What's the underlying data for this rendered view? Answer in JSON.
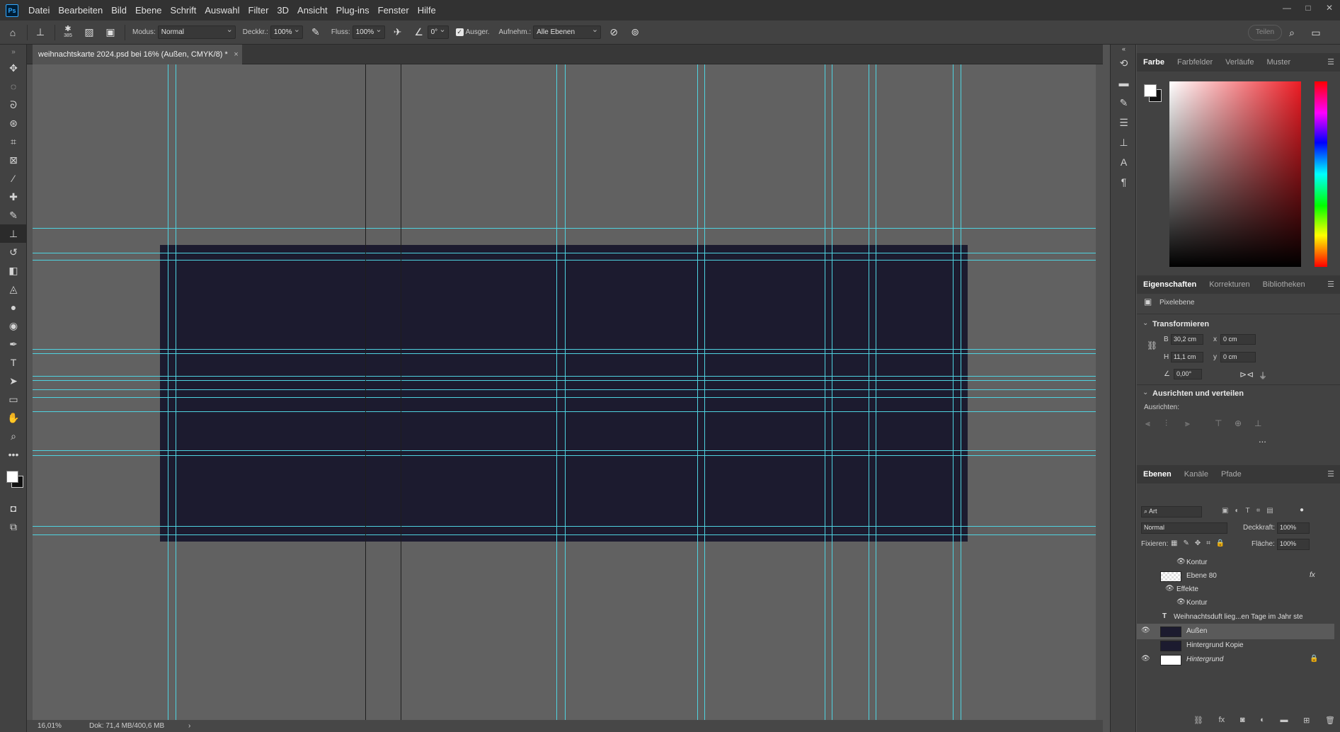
{
  "app": {
    "logo": "Ps"
  },
  "menu": [
    "Datei",
    "Bearbeiten",
    "Bild",
    "Ebene",
    "Schrift",
    "Auswahl",
    "Filter",
    "3D",
    "Ansicht",
    "Plug-ins",
    "Fenster",
    "Hilfe"
  ],
  "window_controls": {
    "minimize": "—",
    "maximize": "□",
    "close": "✕"
  },
  "options": {
    "brush_size": "385",
    "mode_label": "Modus:",
    "mode_value": "Normal",
    "opacity_label": "Deckkr.:",
    "opacity_value": "100%",
    "flow_label": "Fluss:",
    "flow_value": "100%",
    "angle_value": "0°",
    "aligned_label": "Ausger.",
    "sample_label": "Aufnehm.:",
    "sample_value": "Alle Ebenen",
    "share_label": "Teilen"
  },
  "document": {
    "tab_title": "weihnachtskarte 2024.psd bei 16% (Außen, CMYK/8) *",
    "close": "×",
    "artboard_color": "#1c1b2f",
    "guide_color": "#4fd3e0"
  },
  "status": {
    "zoom": "16,01%",
    "doc_info": "Dok: 71,4 MB/400,6 MB",
    "arrow": "›"
  },
  "color_panel": {
    "tabs": [
      "Farbe",
      "Farbfelder",
      "Verläufe",
      "Muster"
    ],
    "active_tab": "Farbe",
    "foreground": "#ffffff",
    "background": "#111111"
  },
  "properties_panel": {
    "tabs": [
      "Eigenschaften",
      "Korrekturen",
      "Bibliotheken"
    ],
    "active_tab": "Eigenschaften",
    "layer_type": "Pixelebene",
    "transform_title": "Transformieren",
    "width_label": "B",
    "width_value": "30,2 cm",
    "height_label": "H",
    "height_value": "11,1 cm",
    "x_label": "x",
    "x_value": "0 cm",
    "y_label": "y",
    "y_value": "0 cm",
    "angle_value": "0,00°",
    "align_title": "Ausrichten und verteilen",
    "align_label": "Ausrichten:",
    "more": "..."
  },
  "layers_panel": {
    "tabs": [
      "Ebenen",
      "Kanäle",
      "Pfade"
    ],
    "active_tab": "Ebenen",
    "filter_label": "Art",
    "blend_mode": "Normal",
    "opacity_label": "Deckkraft:",
    "opacity_value": "100%",
    "lock_label": "Fixieren:",
    "fill_label": "Fläche:",
    "fill_value": "100%",
    "layers": [
      {
        "name": "Kontur",
        "kind": "effect-sub"
      },
      {
        "name": "Ebene 80",
        "kind": "pixel",
        "fx": "fx"
      },
      {
        "name": "Effekte",
        "kind": "effect-group"
      },
      {
        "name": "Kontur",
        "kind": "effect-sub"
      },
      {
        "name": "Weihnachtsduft lieg...en Tage im Jahr ste",
        "kind": "text"
      },
      {
        "name": "Außen",
        "kind": "pixel",
        "visible": true,
        "selected": true
      },
      {
        "name": "Hintergrund Kopie",
        "kind": "pixel"
      },
      {
        "name": "Hintergrund",
        "kind": "background",
        "visible": true,
        "locked": true
      }
    ]
  }
}
